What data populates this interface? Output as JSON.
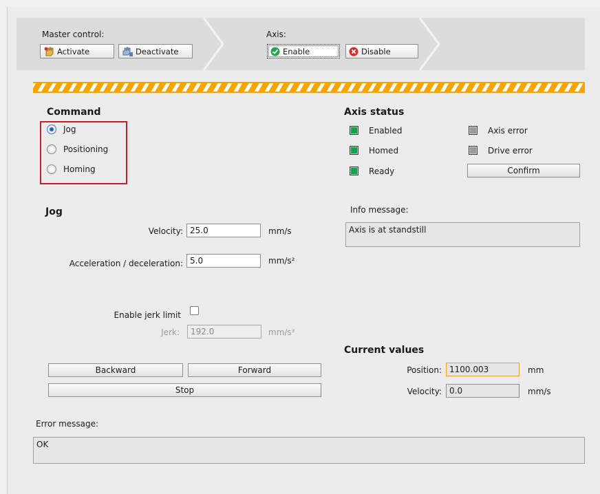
{
  "master_control": {
    "label": "Master control:",
    "activate_label": "Activate",
    "deactivate_label": "Deactivate"
  },
  "axis": {
    "label": "Axis:",
    "enable_label": "Enable",
    "disable_label": "Disable"
  },
  "command": {
    "title": "Command",
    "options": [
      {
        "label": "Jog",
        "selected": true
      },
      {
        "label": "Positioning",
        "selected": false
      },
      {
        "label": "Homing",
        "selected": false
      }
    ]
  },
  "jog": {
    "title": "Jog",
    "velocity_label": "Velocity:",
    "velocity_value": "25.0",
    "velocity_unit": "mm/s",
    "accel_label": "Acceleration / deceleration:",
    "accel_value": "5.0",
    "accel_unit": "mm/s²",
    "jerk_limit_label": "Enable jerk limit",
    "jerk_limit_checked": false,
    "jerk_label": "Jerk:",
    "jerk_value": "192.0",
    "jerk_unit": "mm/s³",
    "backward_label": "Backward",
    "forward_label": "Forward",
    "stop_label": "Stop"
  },
  "axis_status": {
    "title": "Axis status",
    "enabled_label": "Enabled",
    "homed_label": "Homed",
    "ready_label": "Ready",
    "axis_error_label": "Axis error",
    "drive_error_label": "Drive error",
    "confirm_label": "Confirm",
    "colors": {
      "active": "#19a04a",
      "inactive": "#9a9a9a"
    }
  },
  "info": {
    "label": "Info message:",
    "message": "Axis is at standstill"
  },
  "current_values": {
    "title": "Current values",
    "position_label": "Position:",
    "position_value": "1100.003",
    "position_unit": "mm",
    "velocity_label": "Velocity:",
    "velocity_value": "0.0",
    "velocity_unit": "mm/s"
  },
  "error": {
    "label": "Error message:",
    "message": "OK"
  },
  "colors": {
    "hazard": "#f5a400",
    "highlight_frame": "#c0202a",
    "radio_selected": "#1f62b8"
  }
}
